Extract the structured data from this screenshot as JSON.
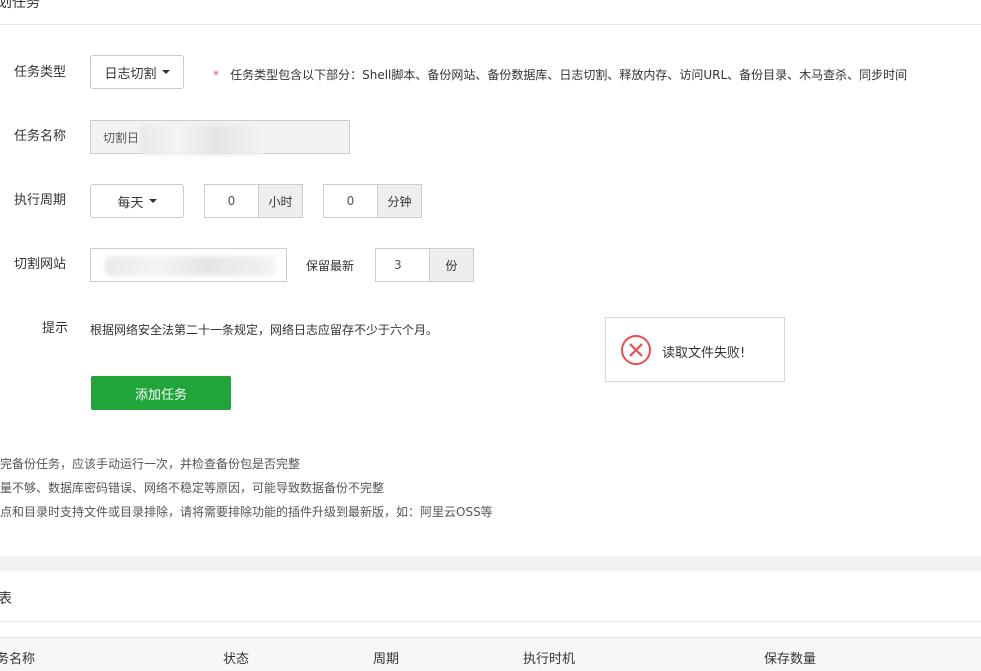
{
  "panel": {
    "title": "划任务"
  },
  "form": {
    "task_type": {
      "label": "任务类型",
      "selected": "日志切割",
      "hint_star": "*",
      "hint": "任务类型包含以下部分：Shell脚本、备份网站、备份数据库、日志切割、释放内存、访问URL、备份目录、木马查杀、同步时间"
    },
    "task_name": {
      "label": "任务名称",
      "value": "切割日"
    },
    "cycle": {
      "label": "执行周期",
      "selected": "每天",
      "hour_value": "0",
      "hour_unit": "小时",
      "minute_value": "0",
      "minute_unit": "分钟"
    },
    "site": {
      "label": "切割网站",
      "keep_label": "保留最新",
      "keep_value": "3",
      "keep_unit": "份"
    },
    "tip": {
      "label": "提示",
      "text": "根据网络安全法第二十一条规定，网络日志应留存不少于六个月。"
    },
    "submit_label": "添加任务"
  },
  "toast": {
    "message": "读取文件失败!",
    "icon": "error-circle-icon",
    "color": "#e94f4f"
  },
  "notes": [
    "加完备份任务，应该手动运行一次，并检查备份包是否完整",
    "容量不够、数据库密码错误、网络不稳定等原因，可能导致数据备份不完整",
    "站点和目录时支持文件或目录排除，请将需要排除功能的插件升级到最新版，如：阿里云OSS等"
  ],
  "list": {
    "title": "表",
    "columns": [
      "务名称",
      "状态",
      "周期",
      "执行时机",
      "保存数量"
    ]
  },
  "colors": {
    "accent": "#20a53a",
    "error": "#e94f4f"
  }
}
